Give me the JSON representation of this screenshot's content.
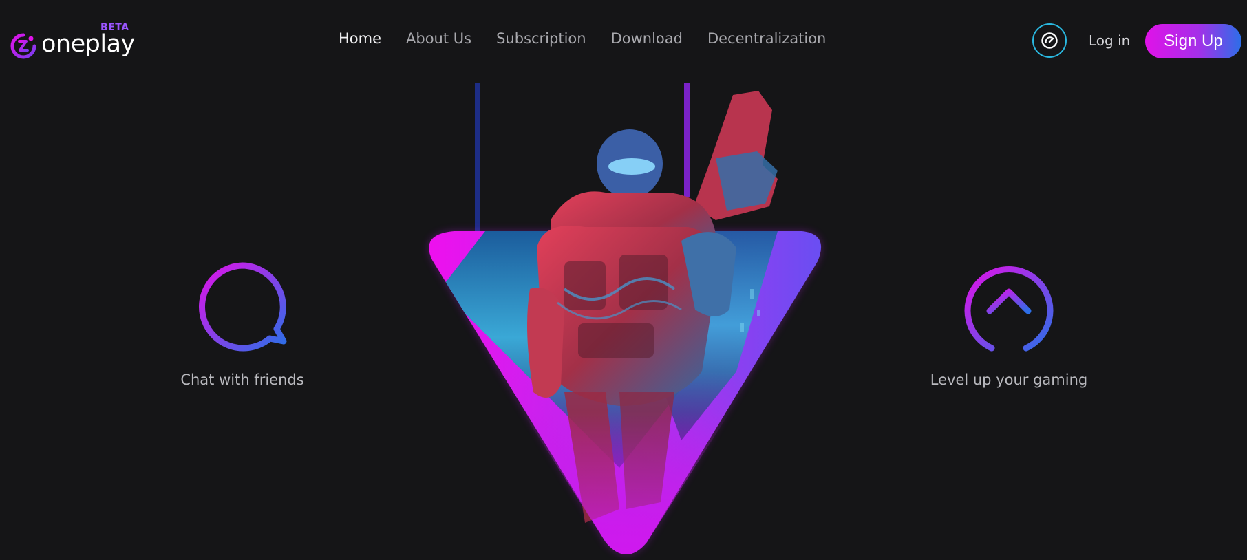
{
  "brand": {
    "name": "oneplay",
    "badge": "BETA",
    "logo_icon": "oneplay-logo-icon"
  },
  "nav": {
    "items": [
      {
        "label": "Home",
        "active": true
      },
      {
        "label": "About Us",
        "active": false
      },
      {
        "label": "Subscription",
        "active": false
      },
      {
        "label": "Download",
        "active": false
      },
      {
        "label": "Decentralization",
        "active": false
      }
    ]
  },
  "header": {
    "speed_icon": "speedometer-icon",
    "login_label": "Log in",
    "signup_label": "Sign Up"
  },
  "features": {
    "left": {
      "label": "Chat with friends",
      "icon": "chat-bubble-icon"
    },
    "right": {
      "label": "Level up your gaming",
      "icon": "arrow-up-circle-icon"
    }
  },
  "hero": {
    "image": "armored-soldier-with-rifle-in-gradient-triangle"
  },
  "colors": {
    "background": "#151517",
    "gradient_start": "#e012e8",
    "gradient_mid": "#a52fe8",
    "gradient_end": "#2c6fe8",
    "nav_active": "#f2f2f4",
    "nav_inactive": "#a9a9ae",
    "beta": "#9a55ff",
    "speed_ring": "#2ab8e0"
  }
}
